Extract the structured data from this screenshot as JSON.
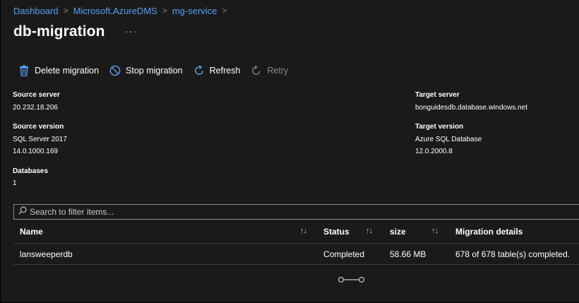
{
  "breadcrumb": {
    "items": [
      "Dashboard",
      "Microsoft.AzureDMS",
      "mg-service"
    ],
    "separator": ">"
  },
  "page": {
    "title": "db-migration",
    "more": "···"
  },
  "toolbar": {
    "delete_label": "Delete migration",
    "stop_label": "Stop migration",
    "refresh_label": "Refresh",
    "retry_label": "Retry"
  },
  "essentials": {
    "source_server_label": "Source server",
    "source_server": "20.232.18.206",
    "target_server_label": "Target server",
    "target_server": "bonguidesdb.database.windows.net",
    "source_version_label": "Source version",
    "source_version_line1": "SQL Server 2017",
    "source_version_line2": "14.0.1000.169",
    "target_version_label": "Target version",
    "target_version_line1": "Azure SQL Database",
    "target_version_line2": "12.0.2000.8",
    "databases_label": "Databases",
    "databases_count": "1"
  },
  "filter": {
    "placeholder": "Search to filter items..."
  },
  "table": {
    "columns": [
      "Name",
      "Status",
      "size",
      "Migration details"
    ],
    "sort_glyph": "↑↓",
    "rows": [
      {
        "name": "lansweeperdb",
        "status": "Completed",
        "size": "58.66 MB",
        "details": "678 of 678 table(s) completed."
      }
    ]
  },
  "colors": {
    "background": "#1b1a19",
    "link": "#4fa3f7",
    "icon_accent": "#4fa3f7",
    "disabled": "#8a8886",
    "divider": "#3b3a39"
  },
  "icons": {
    "delete": "trash-icon",
    "stop": "stop-circle-icon",
    "refresh": "refresh-icon",
    "retry": "retry-icon",
    "search": "search-icon",
    "pager": "loading-indicator"
  }
}
